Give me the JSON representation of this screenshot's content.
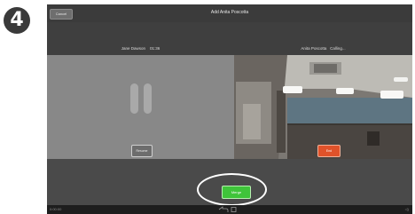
{
  "step": {
    "number": "4"
  },
  "topbar": {
    "cancel_label": "Cancel",
    "title": "Add Anita Poscotta"
  },
  "participants": {
    "left": {
      "name": "Jane Dawson",
      "timer": "01:36"
    },
    "right": {
      "name": "Anita Poscotta",
      "status": "Calling..."
    }
  },
  "buttons": {
    "resume_label": "Resume",
    "end_label": "End",
    "merge_label": "Merge"
  },
  "navbar": {
    "time": "0:00:00",
    "right_text": "◁)"
  },
  "colors": {
    "end": "#e0522a",
    "merge": "#3fc43a"
  },
  "icons": {
    "pause": "pause-icon",
    "back": "back-icon",
    "home": "home-icon"
  }
}
